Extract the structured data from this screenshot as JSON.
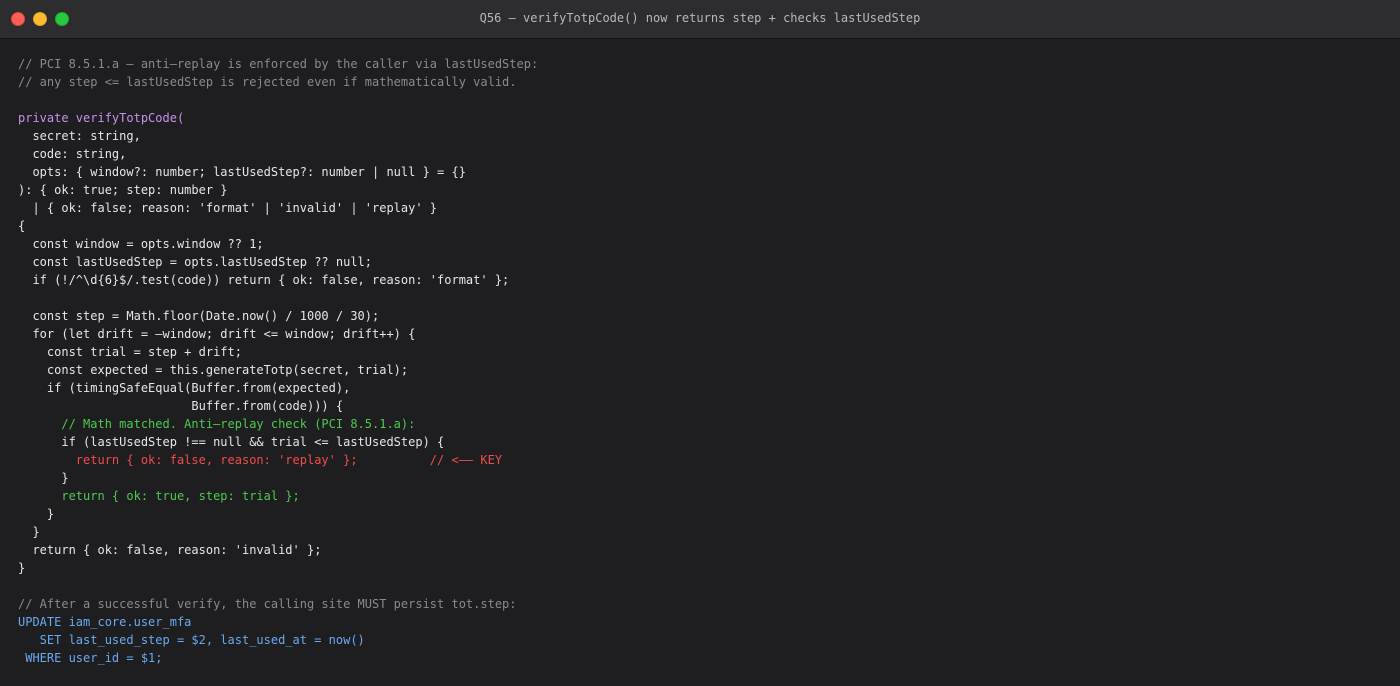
{
  "window": {
    "title": "Q56 — verifyTotpCode() now returns step + checks lastUsedStep",
    "controls": [
      "close",
      "minimize",
      "maximize"
    ]
  },
  "colors": {
    "background": "#1e1e20",
    "titlebar": "#2d2d30",
    "comment": "#8a8a8e",
    "text": "#e6e6e6",
    "keyword": "#c792ea",
    "green": "#4ec94e",
    "red": "#f14c4c",
    "blue": "#69a9f0"
  },
  "code": {
    "lines": [
      {
        "text": "// PCI 8.5.1.a — anti–replay is enforced by the caller via lastUsedStep:",
        "style": "comment"
      },
      {
        "text": "// any step <= lastUsedStep is rejected even if mathematically valid.",
        "style": "comment"
      },
      {
        "text": "",
        "style": "default"
      },
      {
        "text": "private verifyTotpCode(",
        "style": "keyword"
      },
      {
        "text": "  secret: string,",
        "style": "default"
      },
      {
        "text": "  code: string,",
        "style": "default"
      },
      {
        "text": "  opts: { window?: number; lastUsedStep?: number | null } = {}",
        "style": "default"
      },
      {
        "text": "): { ok: true; step: number }",
        "style": "default"
      },
      {
        "text": "  | { ok: false; reason: 'format' | 'invalid' | 'replay' }",
        "style": "default"
      },
      {
        "text": "{",
        "style": "default"
      },
      {
        "text": "  const window = opts.window ?? 1;",
        "style": "default"
      },
      {
        "text": "  const lastUsedStep = opts.lastUsedStep ?? null;",
        "style": "default"
      },
      {
        "text": "  if (!/^\\d{6}$/.test(code)) return { ok: false, reason: 'format' };",
        "style": "default"
      },
      {
        "text": "",
        "style": "default"
      },
      {
        "text": "  const step = Math.floor(Date.now() / 1000 / 30);",
        "style": "default"
      },
      {
        "text": "  for (let drift = –window; drift <= window; drift++) {",
        "style": "default"
      },
      {
        "text": "    const trial = step + drift;",
        "style": "default"
      },
      {
        "text": "    const expected = this.generateTotp(secret, trial);",
        "style": "default"
      },
      {
        "text": "    if (timingSafeEqual(Buffer.from(expected),",
        "style": "default"
      },
      {
        "text": "                        Buffer.from(code))) {",
        "style": "default"
      },
      {
        "text": "      // Math matched. Anti–replay check (PCI 8.5.1.a):",
        "style": "green"
      },
      {
        "text": "      if (lastUsedStep !== null && trial <= lastUsedStep) {",
        "style": "default"
      },
      {
        "text": "        return { ok: false, reason: 'replay' };          // <–– KEY",
        "style": "red"
      },
      {
        "text": "      }",
        "style": "default"
      },
      {
        "text": "      return { ok: true, step: trial };",
        "style": "green"
      },
      {
        "text": "    }",
        "style": "default"
      },
      {
        "text": "  }",
        "style": "default"
      },
      {
        "text": "  return { ok: false, reason: 'invalid' };",
        "style": "default"
      },
      {
        "text": "}",
        "style": "default"
      },
      {
        "text": "",
        "style": "default"
      },
      {
        "text": "// After a successful verify, the calling site MUST persist tot.step:",
        "style": "comment"
      },
      {
        "text": "UPDATE iam_core.user_mfa",
        "style": "blue"
      },
      {
        "text": "   SET last_used_step = $2, last_used_at = now()",
        "style": "blue"
      },
      {
        "text": " WHERE user_id = $1;",
        "style": "blue"
      }
    ]
  }
}
